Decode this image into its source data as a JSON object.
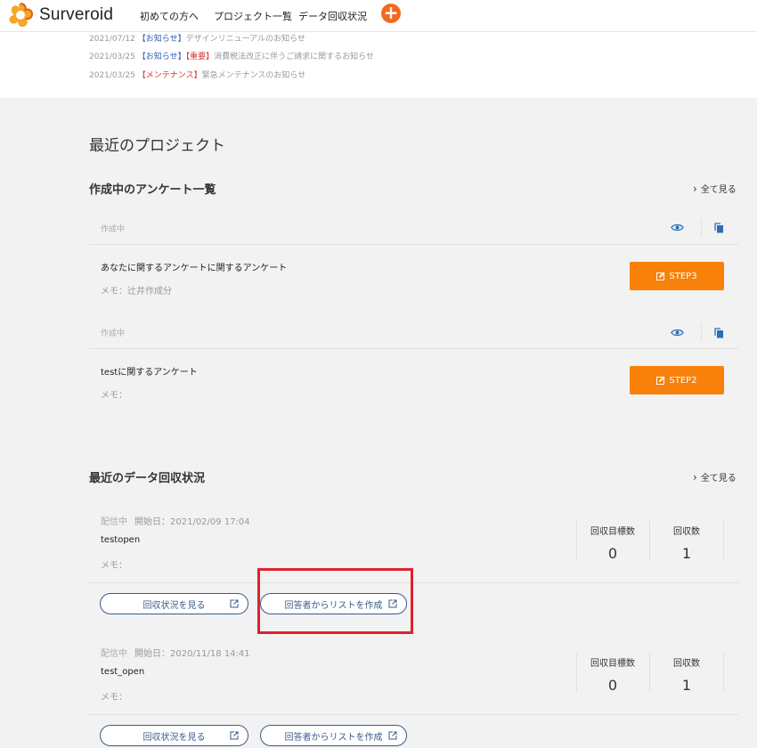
{
  "header": {
    "logo_text": "Surveroid",
    "nav": [
      "初めての方へ",
      "プロジェクト一覧",
      "データ回収状況"
    ],
    "plus": "+"
  },
  "news": [
    {
      "date": "2021/07/12",
      "tags": [
        {
          "text": "【お知らせ】",
          "color": "blue"
        }
      ],
      "text": "デザインリニューアルのお知らせ"
    },
    {
      "date": "2021/03/25",
      "tags": [
        {
          "text": "【お知らせ】",
          "color": "blue"
        },
        {
          "text": "【重要】",
          "color": "red"
        }
      ],
      "text": "消費税法改正に伴うご請求に関するお知らせ"
    },
    {
      "date": "2021/03/25",
      "tags": [
        {
          "text": "【メンテナンス】",
          "color": "red"
        }
      ],
      "text": "緊急メンテナンスのお知らせ"
    }
  ],
  "main": {
    "page_title": "最近のプロジェクト",
    "surveys_section": {
      "title": "作成中のアンケート一覧",
      "see_all": "全て見る",
      "items": [
        {
          "status": "作成中",
          "title": "あなたに関するアンケートに関するアンケート",
          "memo": "メモ：辻井作成分",
          "step": "STEP3"
        },
        {
          "status": "作成中",
          "title": "testに関するアンケート",
          "memo": "メモ：",
          "step": "STEP2"
        }
      ]
    },
    "data_section": {
      "title": "最近のデータ回収状況",
      "see_all": "全て見る",
      "items": [
        {
          "status": "配信中",
          "start": "開始日：2021/02/09 17:04",
          "title": "testopen",
          "memo": "メモ：",
          "target_label": "回収目標数",
          "target_value": "0",
          "count_label": "回収数",
          "count_value": "1",
          "btn_status": "回収状況を見る",
          "btn_list": "回答者からリストを作成"
        },
        {
          "status": "配信中",
          "start": "開始日：2020/11/18 14:41",
          "title": "test_open",
          "memo": "メモ：",
          "target_label": "回収目標数",
          "target_value": "0",
          "count_label": "回収数",
          "count_value": "1",
          "btn_status": "回収状況を見る",
          "btn_list": "回答者からリストを作成"
        }
      ]
    }
  },
  "colors": {
    "accent": "#f7810a",
    "brand_plus": "#f26a21",
    "button_outline": "#3a5a8c",
    "highlight": "#e0222b"
  }
}
